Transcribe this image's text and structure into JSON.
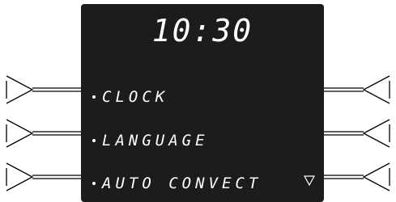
{
  "display": {
    "time": "10:30",
    "background_color": "#1c1c1c",
    "text_color": "#ffffff"
  },
  "menu": {
    "items": [
      {
        "label": "CLOCK"
      },
      {
        "label": "LANGUAGE"
      },
      {
        "label": "AUTO CONVECT"
      }
    ],
    "scroll_indicator_icon": "triangle-down-icon"
  },
  "side_buttons": {
    "left_icon": "left-pointer-button-icon",
    "right_icon": "right-pointer-button-icon"
  }
}
